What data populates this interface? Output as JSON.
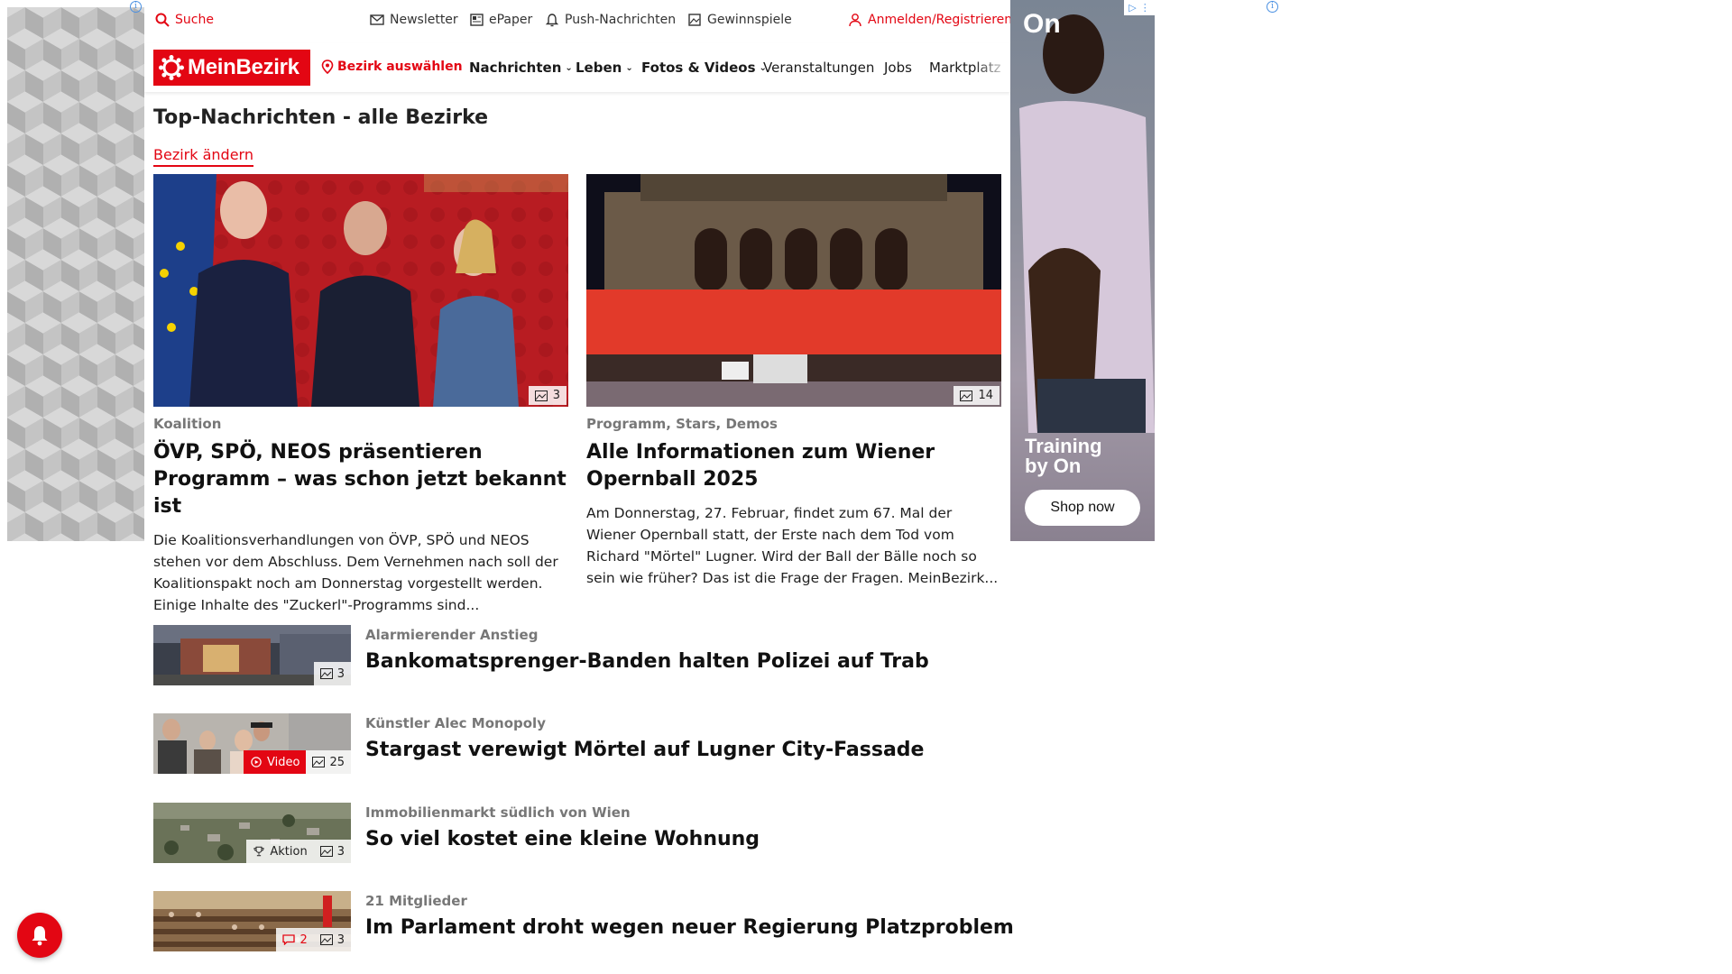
{
  "topbar": {
    "search": "Suche",
    "newsletter": "Newsletter",
    "epaper": "ePaper",
    "push": "Push-Nachrichten",
    "gewinnspiele": "Gewinnspiele",
    "login": "Anmelden/Registrieren"
  },
  "navbar": {
    "logo_text": "MeinBezirk",
    "bezirk_select": "Bezirk auswählen",
    "items": [
      "Nachrichten",
      "Leben",
      "Fotos & Videos",
      "Veranstaltungen",
      "Jobs",
      "Marktplatz"
    ]
  },
  "page": {
    "title": "Top-Nachrichten - alle Bezirke",
    "change_bezirk": "Bezirk ändern"
  },
  "features": [
    {
      "kicker": "Koalition",
      "headline": "ÖVP, SPÖ, NEOS präsentieren Programm – was schon jetzt bekannt ist",
      "teaser": "Die Koalitionsverhandlungen von ÖVP, SPÖ und NEOS stehen vor dem Abschluss. Dem Vernehmen nach soll der Koalitionspakt noch am Donnerstag vorgestellt werden. Einige Inhalte des \"Zuckerl\"-Programms sind...",
      "photo_count": "3"
    },
    {
      "kicker": "Programm, Stars, Demos",
      "headline": "Alle Informationen zum Wiener Opernball 2025",
      "teaser": "Am Donnerstag, 27. Februar, findet zum 67. Mal der Wiener Opernball statt, der Erste nach dem Tod vom Richard \"Mörtel\" Lugner. Wird der Ball der Bälle noch so sein wie früher? Das ist die Frage der Fragen. MeinBezirk...",
      "photo_count": "14"
    }
  ],
  "articles": [
    {
      "kicker": "Alarmierender Anstieg",
      "headline": "Bankomatsprenger-Banden halten Polizei auf Trab",
      "photo_count": "3"
    },
    {
      "kicker": "Künstler Alec Monopoly",
      "headline": "Stargast verewigt Mörtel auf Lugner City-Fassade",
      "video_label": "Video",
      "photo_count": "25"
    },
    {
      "kicker": "Immobilienmarkt südlich von Wien",
      "headline": "So viel kostet eine kleine Wohnung",
      "action_label": "Aktion",
      "photo_count": "3"
    },
    {
      "kicker": "21 Mitglieder",
      "headline": "Im Parlament droht wegen neuer Regierung Platzproblem",
      "comment_count": "2",
      "photo_count": "3"
    }
  ],
  "ad_right": {
    "brand": "On",
    "tagline": "Training by On",
    "cta": "Shop now"
  },
  "colors": {
    "brand_red": "#e30613"
  }
}
